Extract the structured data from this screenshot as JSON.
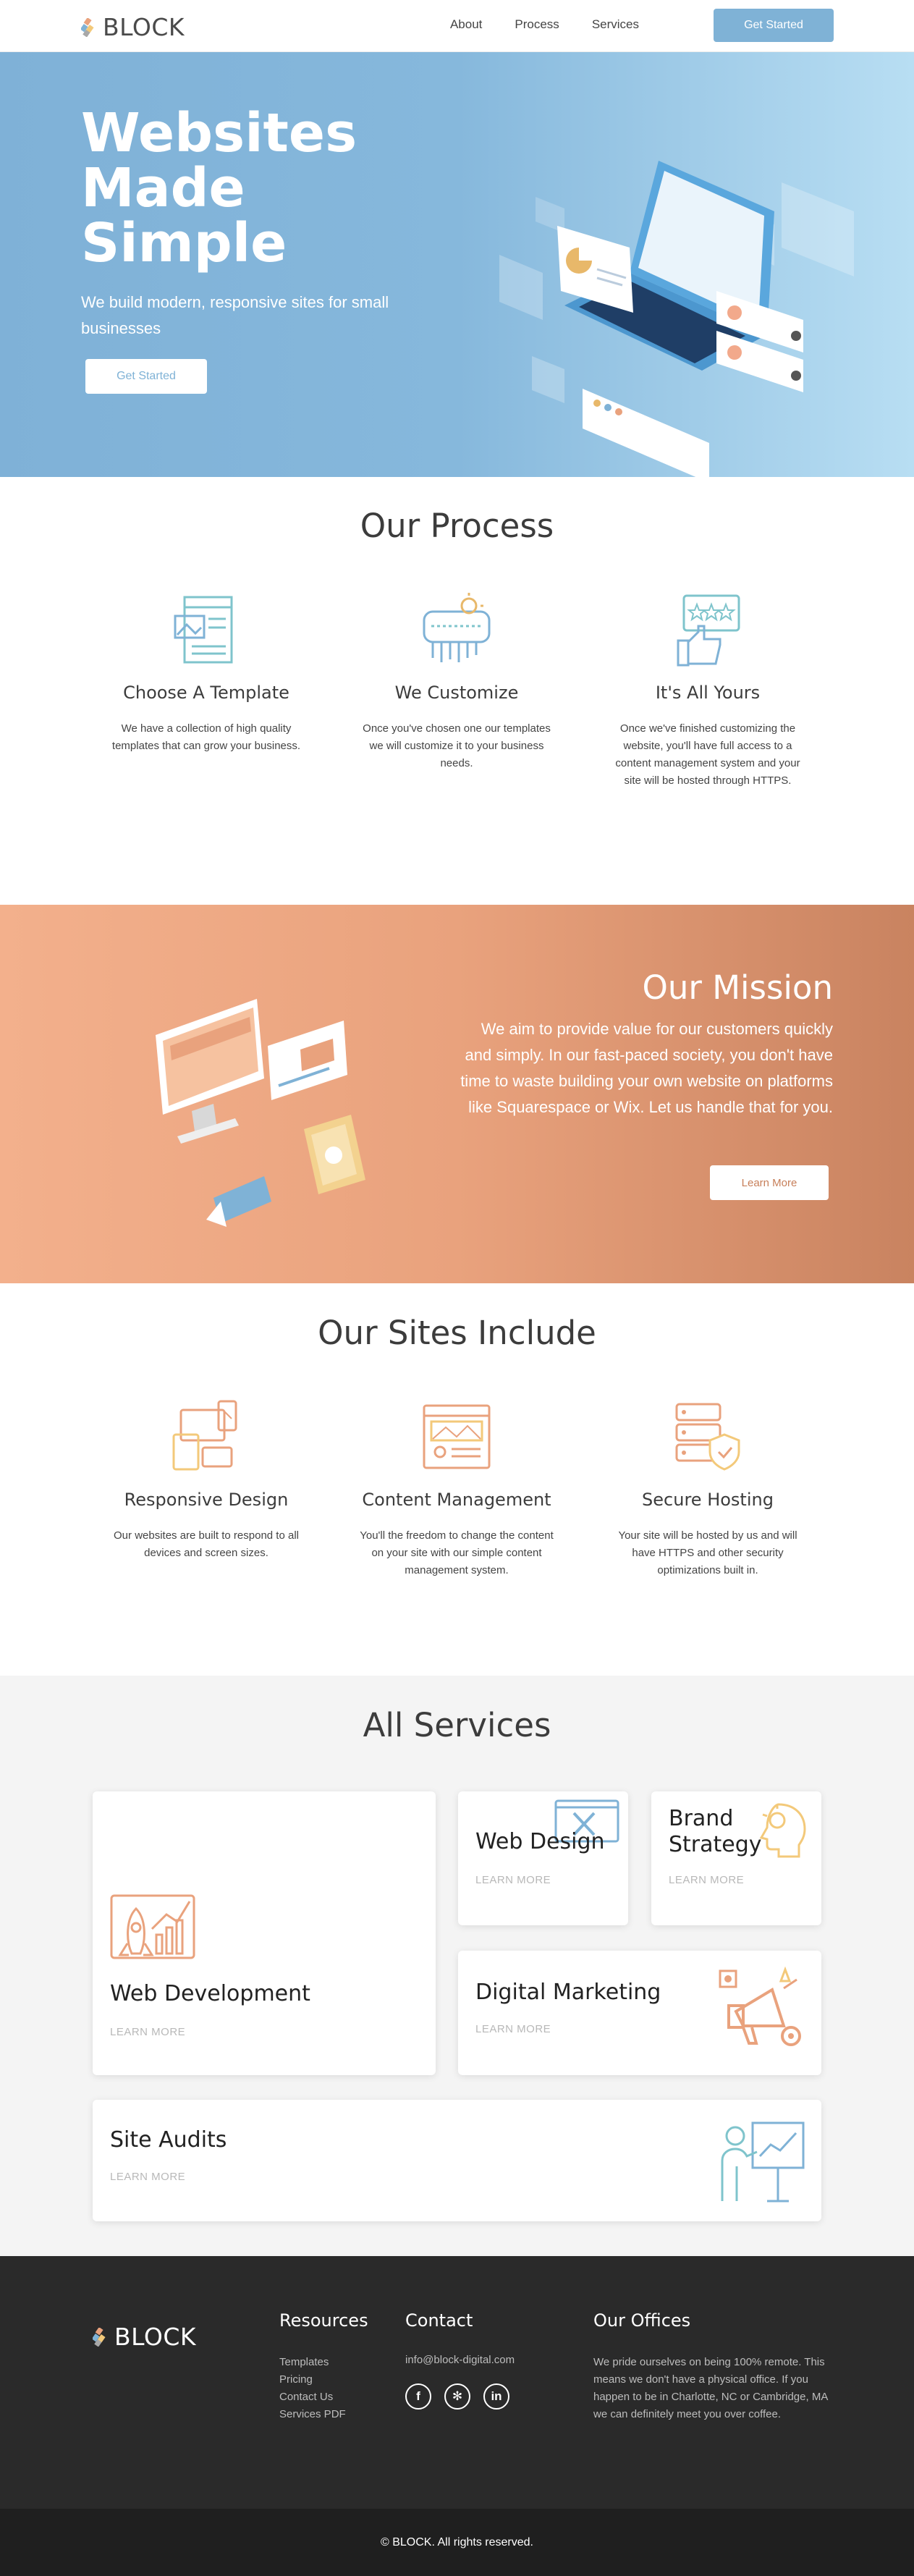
{
  "brand": {
    "name": "BLOCK"
  },
  "nav": {
    "links": [
      "About",
      "Process",
      "Services"
    ],
    "cta": "Get Started"
  },
  "hero": {
    "title": "Websites Made Simple",
    "subtitle": "We build modern, responsive sites for small businesses",
    "cta": "Get Started"
  },
  "process": {
    "title": "Our Process",
    "items": [
      {
        "icon": "template-icon",
        "title": "Choose A Template",
        "text": "We have a collection of high quality templates that can grow your business."
      },
      {
        "icon": "customize-icon",
        "title": "We Customize",
        "text": "Once you've chosen one our templates we will customize it to your business needs."
      },
      {
        "icon": "thumbs-up-icon",
        "title": "It's All Yours",
        "text": "Once we've finished customizing the website, you'll have full access to a content management system and your site will be hosted through HTTPS."
      }
    ]
  },
  "mission": {
    "title": "Our Mission",
    "text": "We aim to provide value for our customers quickly and simply. In our fast-paced society, you don't have time to waste building your own website on platforms like Squarespace or Wix. Let us handle that for you.",
    "cta": "Learn More"
  },
  "includes": {
    "title": "Our Sites Include",
    "items": [
      {
        "icon": "responsive-devices-icon",
        "title": "Responsive Design",
        "text": "Our websites are built to respond to all devices and screen sizes."
      },
      {
        "icon": "content-management-icon",
        "title": "Content Management",
        "text": "You'll the freedom to change the content on your site with our simple content management system."
      },
      {
        "icon": "secure-hosting-icon",
        "title": "Secure Hosting",
        "text": "Your site will be hosted by us and will have HTTPS and other security optimizations built in."
      }
    ]
  },
  "services": {
    "title": "All Services",
    "cards": [
      {
        "title": "Web Development",
        "link": "LEARN MORE",
        "icon": "rocket-chart-icon"
      },
      {
        "title": "Web Design",
        "link": "LEARN MORE",
        "icon": "design-tools-icon"
      },
      {
        "title": "Brand Strategy",
        "link": "LEARN MORE",
        "icon": "idea-head-icon"
      },
      {
        "title": "Digital Marketing",
        "link": "LEARN MORE",
        "icon": "megaphone-icon"
      },
      {
        "title": "Site Audits",
        "link": "LEARN MORE",
        "icon": "presentation-icon"
      }
    ]
  },
  "footer": {
    "resources": {
      "title": "Resources",
      "links": [
        "Templates",
        "Pricing",
        "Contact Us",
        "Services PDF"
      ]
    },
    "contact": {
      "title": "Contact",
      "email": "info@block-digital.com",
      "socials": [
        "facebook-icon",
        "yelp-icon",
        "linkedin-icon"
      ]
    },
    "offices": {
      "title": "Our Offices",
      "text": "We pride ourselves on being 100% remote. This means we don't have a physical office. If you happen to be in Charlotte, NC or Cambridge, MA we can definitely meet you over coffee."
    },
    "copyright": "© BLOCK. All rights reserved."
  },
  "colors": {
    "blue": "#7fb2d6",
    "orange": "#e9a27d",
    "dark": "#2a2a2a"
  }
}
